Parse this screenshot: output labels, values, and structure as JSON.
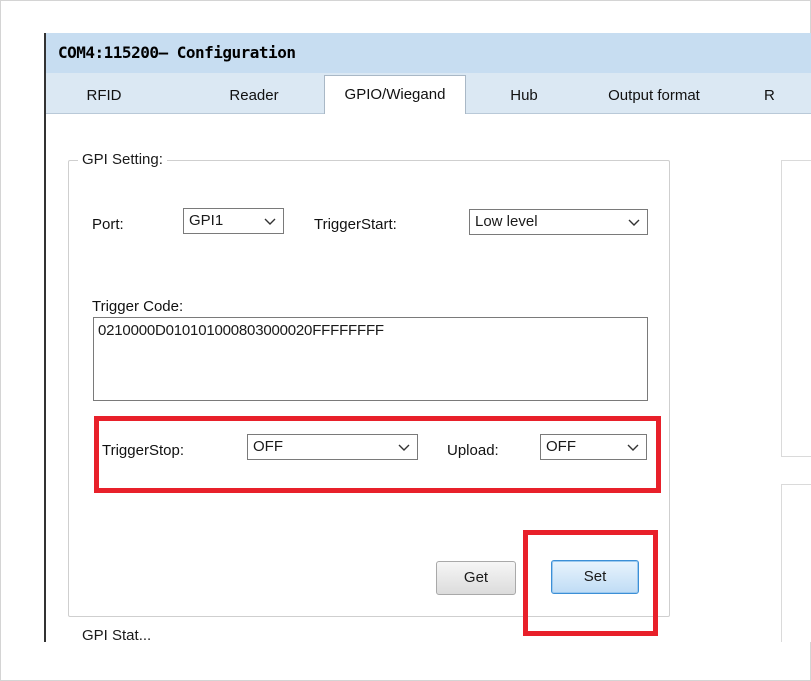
{
  "window": {
    "title": "COM4:115200— Configuration"
  },
  "tabs": [
    {
      "label": "RFID",
      "active": false
    },
    {
      "label": "Reader",
      "active": false
    },
    {
      "label": "GPIO/Wiegand",
      "active": true
    },
    {
      "label": "Hub",
      "active": false
    },
    {
      "label": "Output format",
      "active": false
    },
    {
      "label": "R",
      "active": false
    }
  ],
  "gpi_setting": {
    "legend": "GPI Setting:",
    "port_label": "Port:",
    "port_value": "GPI1",
    "trigger_start_label": "TriggerStart:",
    "trigger_start_value": "Low level",
    "trigger_code_label": "Trigger Code:",
    "trigger_code_value": "0210000D010101000803000020FFFFFFFF",
    "trigger_stop_label": "TriggerStop:",
    "trigger_stop_value": "OFF",
    "upload_label": "Upload:",
    "upload_value": "OFF",
    "get_label": "Get",
    "set_label": "Set"
  },
  "gpi_status": {
    "legend": "GPI Stat..."
  },
  "colors": {
    "highlight": "#e8202a",
    "titlebar": "#c7ddf1",
    "tabbar": "#dbe8f3",
    "set_button_border": "#3c8fd6"
  },
  "icons": {
    "dropdown": "chevron-down-icon"
  }
}
